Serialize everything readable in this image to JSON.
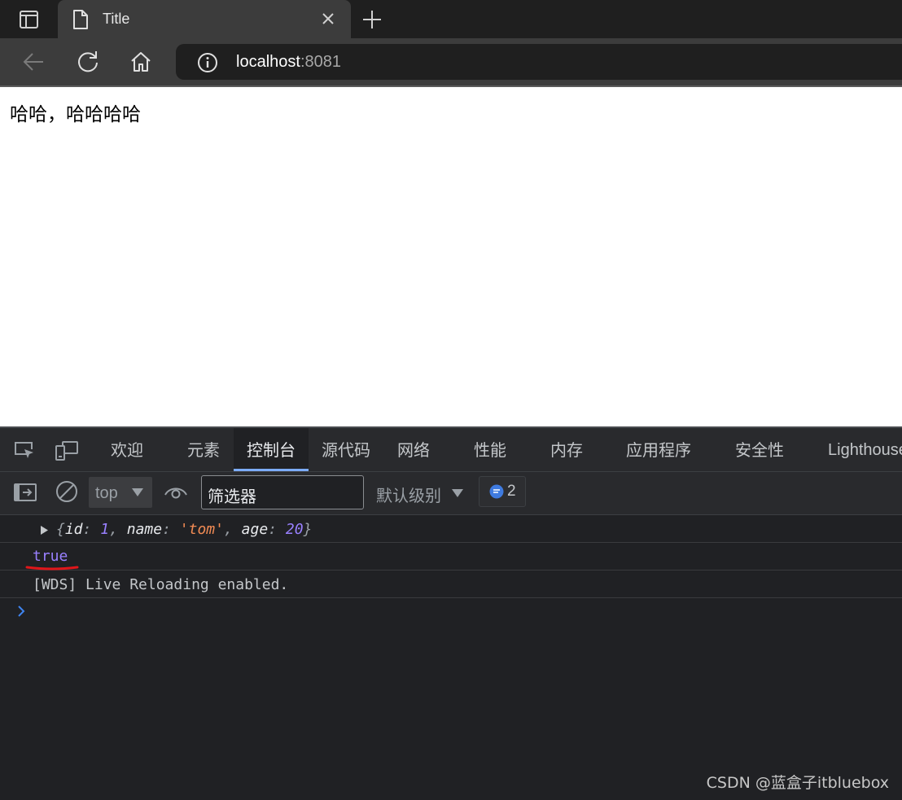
{
  "browser": {
    "tab_title": "Title",
    "url_host": "localhost",
    "url_port": ":8081"
  },
  "page": {
    "text": "哈哈，哈哈哈哈"
  },
  "devtools": {
    "tabs": [
      "欢迎",
      "元素",
      "控制台",
      "源代码",
      "网络",
      "性能",
      "内存",
      "应用程序",
      "安全性",
      "Lighthouse"
    ],
    "active_tab": "控制台",
    "console_toolbar": {
      "context": "top",
      "filter_placeholder": "筛选器",
      "levels": "默认级别",
      "message_count": "2"
    },
    "console": {
      "object_log": {
        "open": "{",
        "key_id": "id",
        "val_id": "1",
        "key_name": "name",
        "val_name": "'tom'",
        "key_age": "age",
        "val_age": "20",
        "close": "}"
      },
      "bool_log": "true",
      "wds_log": "[WDS] Live Reloading enabled."
    }
  },
  "watermark": "CSDN @蓝盒子itbluebox",
  "colors": {
    "console_number": "#9980ff",
    "console_string": "#f28b54",
    "active_tab_underline": "#7cacf8",
    "annotation_underline": "#e0161a",
    "badge_blue": "#3f7be0"
  }
}
